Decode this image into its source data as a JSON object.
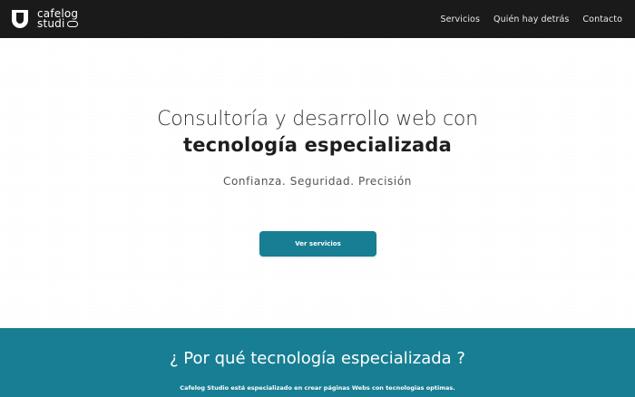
{
  "colors": {
    "topbar_bg": "#1a1a1a",
    "accent": "#177e93",
    "text_dark": "#1e1e1e"
  },
  "brand": {
    "logo_icon": "cafelog-logo-icon",
    "line1": "cafelog",
    "line2": "studi"
  },
  "nav": {
    "items": [
      {
        "label": "Servicios"
      },
      {
        "label": "Quién hay detrás"
      },
      {
        "label": "Contacto"
      }
    ]
  },
  "hero": {
    "title_line1": "Consultoría y desarrollo web con",
    "title_line2": "tecnología especializada",
    "subtitle": "Confianza. Seguridad. Precisión",
    "cta_label": "Ver servicios"
  },
  "why": {
    "title": "¿ Por qué tecnología especializada ?",
    "text": "Cafelog Studio está especializado en crear páginas Webs con tecnologias optimas."
  }
}
